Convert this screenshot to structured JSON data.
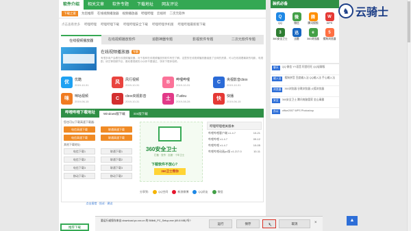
{
  "topnav": {
    "tabs": [
      "软件介绍",
      "相关文章",
      "软件专题",
      "下载地址",
      "网友评论"
    ]
  },
  "subnav": {
    "hot_label": "下载之家",
    "items": [
      "为您推荐",
      "在线视频播放器",
      "视频播放器",
      "哔哩哔哩",
      "云视听",
      "二次元软件"
    ]
  },
  "tags": {
    "lead": "点击查看更多",
    "items": [
      "哔哩哔哩",
      "哔哩哔哩下载",
      "哔哩哔哩安全下载",
      "哔哩哔哩手机版",
      "哔哩哔哩最新版下载"
    ]
  },
  "topic_tabs": [
    "在线视频播放器",
    "在线视频播放软件",
    "追剧神器专题",
    "影视软件专题",
    "二次元软件专题"
  ],
  "feature": {
    "title": "在线视频播放器",
    "badge": "专题",
    "desc": "有很多用户会看在线视频播放器，对于各种在线视频播放的软件有些了解。这里的在线视频播放器涵盖了全网的资源，可以在线观看最新的电影、电视剧、综艺等视频节目，喜欢看视频的小伙伴不要错过，快来下载体验吧。"
  },
  "apps": [
    {
      "name": "优酷",
      "date": "2019-10-31",
      "color": "#1ea1f2",
      "icon": "优"
    },
    {
      "name": "风行视频",
      "date": "2019-10-31",
      "color": "#e9443f",
      "icon": "风"
    },
    {
      "name": "哔哩哔哩",
      "date": "2019-10-31",
      "color": "#fb7299",
      "icon": "B"
    },
    {
      "name": "央视影音cbox",
      "date": "2019-10-31",
      "color": "#2b6bd7",
      "icon": "C"
    },
    {
      "name": "咪咕视频",
      "date": "2019-06-15",
      "color": "#f07b21",
      "icon": "咪"
    },
    {
      "name": "cbox央视影音",
      "date": "2019-10-31",
      "color": "#d32f2f",
      "icon": "C"
    },
    {
      "name": "iTudou",
      "date": "2019-08-28",
      "color": "#e23a88",
      "icon": "土"
    },
    {
      "name": "快播",
      "date": "2019-06-15",
      "color": "#e53935",
      "icon": "快"
    }
  ],
  "download": {
    "heading": "哔哩哔哩下载地址",
    "tabs": [
      "Windows版下载",
      "iOS版下载"
    ],
    "note": "您也可以下载高速下载器:",
    "fast_btn": "电信高速下载",
    "fast_btn2": "联通高速下载",
    "other_caption": "其他下载地址:",
    "normal_btns": [
      "电信下载1",
      "电信下载2",
      "电信下载3",
      "联通下载1",
      "联通下载2",
      "联通下载3",
      "移动下载1",
      "移动下载2"
    ],
    "report": "点击报错 · 投诉 · 建议"
  },
  "ad": {
    "brand": "360安全卫士",
    "sub": "拦截 · 查杀 · 加速 · 十年卫士",
    "question": "下载软件不放心?",
    "cta": "360卫士帮你"
  },
  "related": {
    "heading": "哔哩哔哩相关版本",
    "rows": [
      {
        "name": "哔哩哔哩客户端 v1.4.7",
        "date": "10-21"
      },
      {
        "name": "哔哩哔哩 v1.4.7",
        "date": "09-12"
      },
      {
        "name": "哔哩哔哩 v1.4.7",
        "date": "10-05"
      },
      {
        "name": "哔哩哔哩动画pc版 v1.217.0",
        "date": "10-11"
      }
    ]
  },
  "share": {
    "label": "分享到:",
    "items": [
      {
        "name": "QQ空间",
        "color": "#f5b400"
      },
      {
        "name": "新浪微博",
        "color": "#e6162d"
      },
      {
        "name": "QQ好友",
        "color": "#1e88e5"
      },
      {
        "name": "微信",
        "color": "#43a047"
      }
    ]
  },
  "side": {
    "heading": "装机必备",
    "icons": [
      {
        "name": "QQ",
        "color": "#1e88e5",
        "icon": "Q"
      },
      {
        "name": "微信",
        "color": "#43a047",
        "icon": "微"
      },
      {
        "name": "腾讯视频",
        "color": "#ff8f00",
        "icon": "腾"
      },
      {
        "name": "WPS",
        "color": "#e53935",
        "icon": "W"
      },
      {
        "name": "360安全卫士",
        "color": "#2e7d32",
        "icon": "3"
      },
      {
        "name": "迅雷",
        "color": "#1565c0",
        "icon": "迅"
      },
      {
        "name": "360浏览器",
        "color": "#43a047",
        "icon": "e"
      },
      {
        "name": "搜狗浏览器",
        "color": "#ff7043",
        "icon": "5"
      }
    ],
    "lines": [
      {
        "cat": "聊天",
        "text": "QQ 微信 YY语音 阿里旺旺 QQ轻聊版"
      },
      {
        "cat": "输入法",
        "text": "搜狗拼音 百度输入法 QQ输入法 手心输入法"
      },
      {
        "cat": "浏览器",
        "text": "360浏览器 谷歌浏览器 火狐浏览器"
      },
      {
        "cat": "安全",
        "text": "360安全卫士 腾讯电脑管家 金山毒霸"
      },
      {
        "cat": "办公",
        "text": "office2007 WPS Photoshop"
      }
    ]
  },
  "logo": {
    "text": "云骑士"
  },
  "download_bar": {
    "message": "要运行或保存来自 download.pc.xxx.cn 的 Bilibili_PC_Setup.exe (69.8 MB) 吗?",
    "run": "运行",
    "save": "保存",
    "cancel": "取消",
    "close_icon": "×"
  },
  "bottom_badge": "推荐下载",
  "back_to_top": "▲"
}
